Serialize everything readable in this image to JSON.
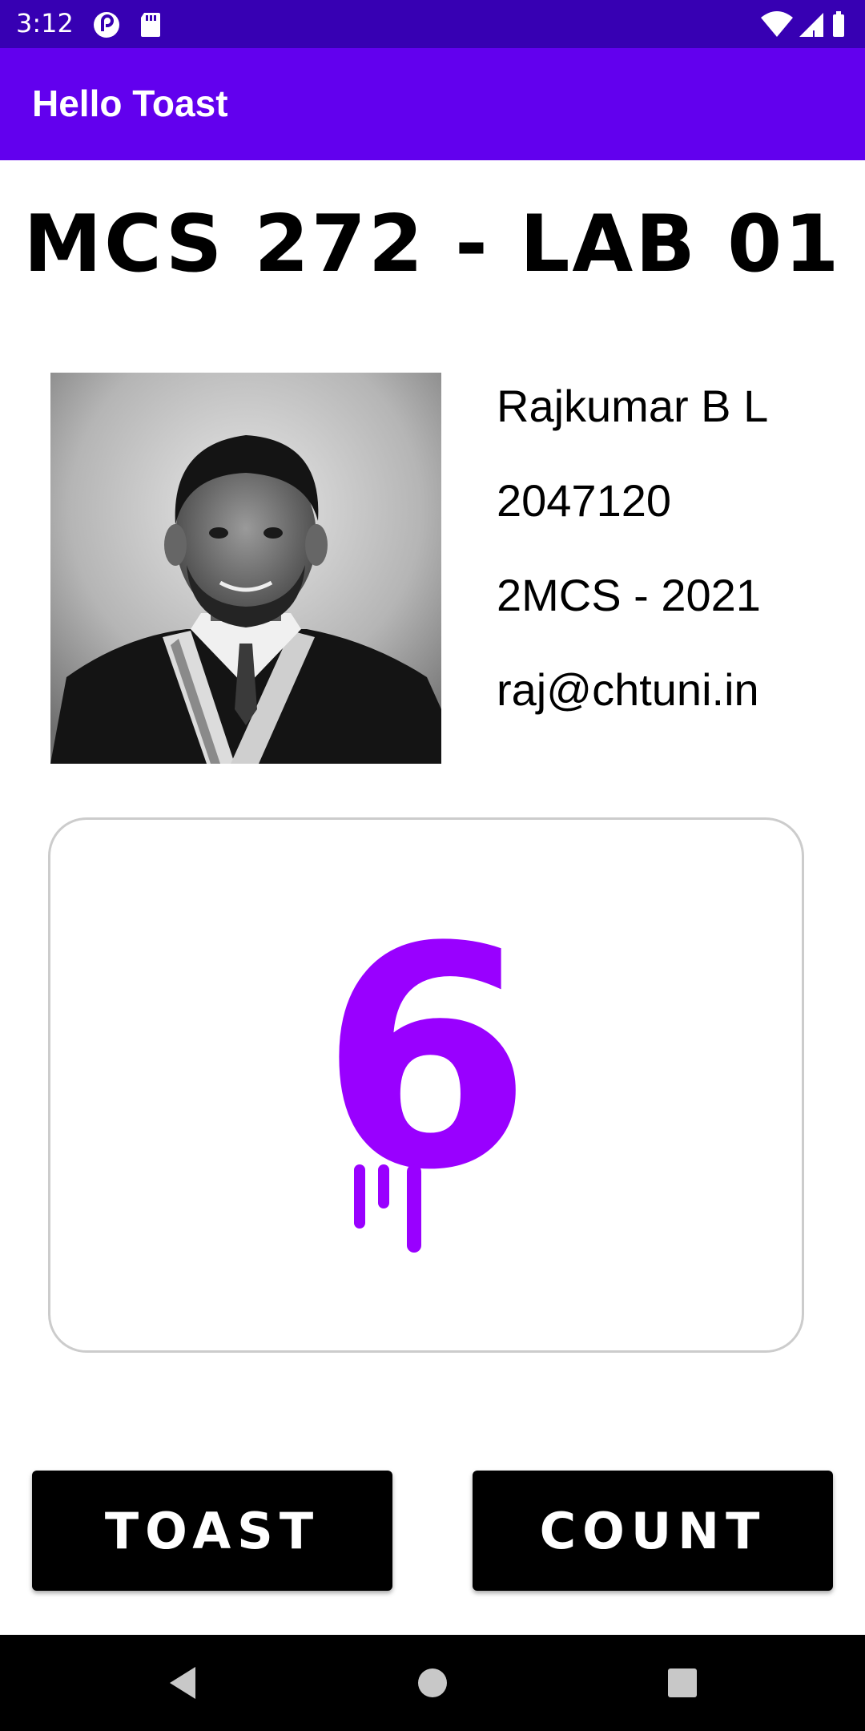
{
  "status_bar": {
    "time": "3:12",
    "left_icons": [
      "pocket-casts-icon",
      "sd-card-icon"
    ],
    "right_icons": [
      "wifi-icon",
      "cellular-signal-icon",
      "battery-icon"
    ]
  },
  "app_bar": {
    "title": "Hello Toast"
  },
  "heading": "MCS 272 - LAB 01",
  "profile": {
    "photo": "graduation portrait photo",
    "name": "Rajkumar B L",
    "id": "2047120",
    "class": "2MCS - 2021",
    "email": "raj@chtuni.in"
  },
  "counter": {
    "value": "6",
    "color": "#9900ff"
  },
  "buttons": {
    "toast_label": "TOAST",
    "count_label": "COUNT"
  },
  "nav_bar": {
    "icons": [
      "back-icon",
      "home-icon",
      "recents-icon"
    ]
  },
  "colors": {
    "status_bar": "#3700b3",
    "app_bar": "#6200ee",
    "accent": "#9900ff",
    "button": "#000000"
  }
}
